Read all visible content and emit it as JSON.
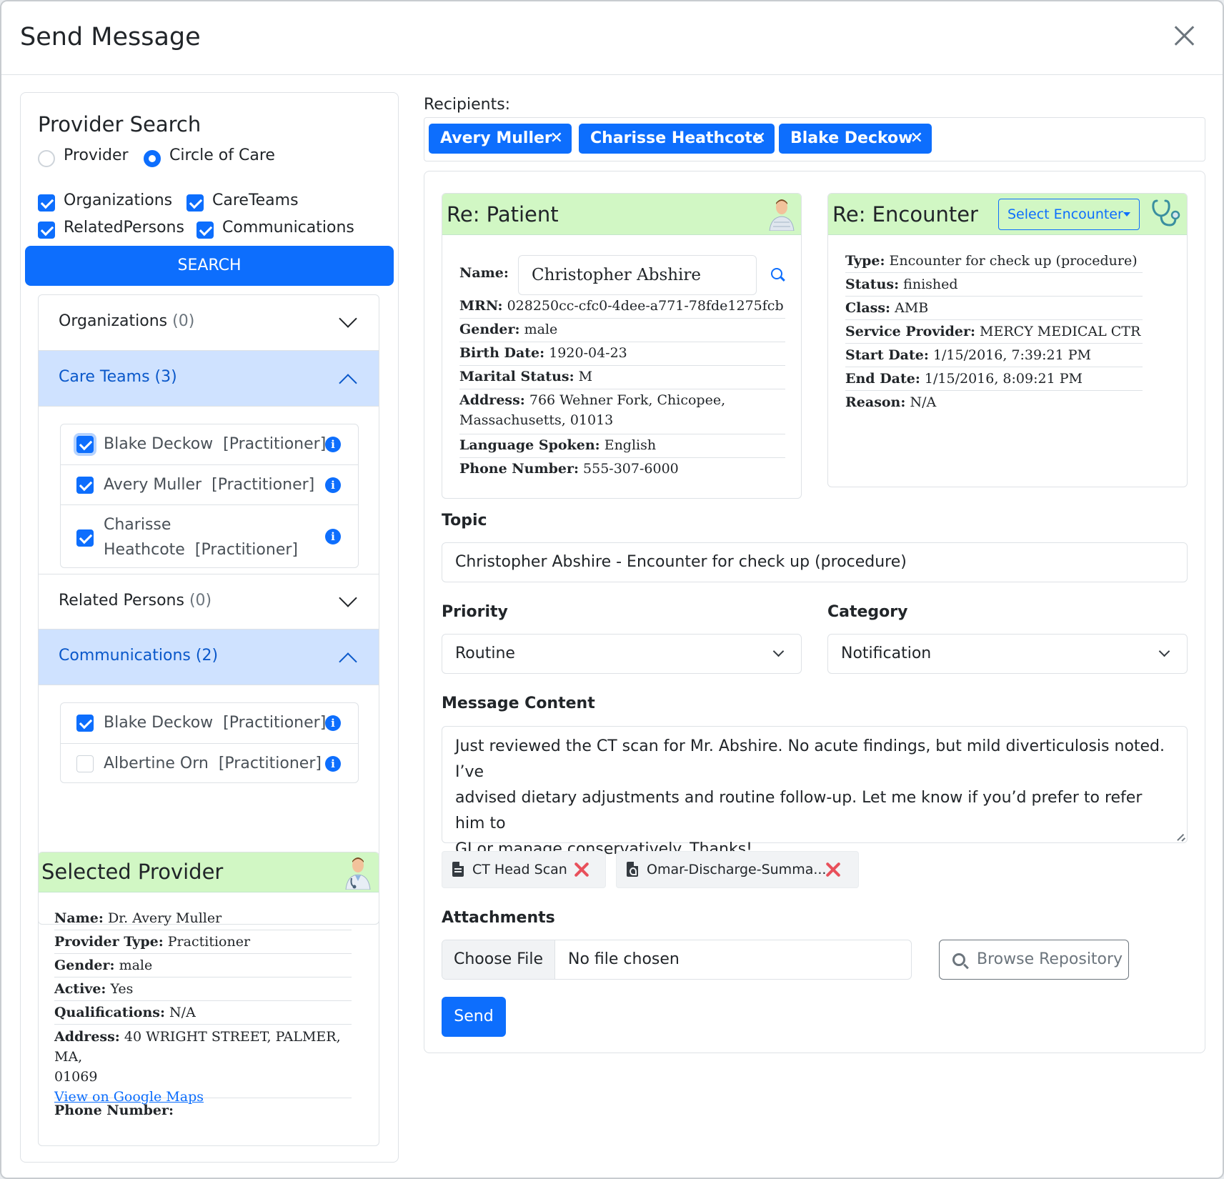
{
  "modal": {
    "title": "Send Message"
  },
  "provider_search": {
    "title": "Provider Search",
    "radios": [
      {
        "label": "Provider",
        "selected": false
      },
      {
        "label": "Circle of Care",
        "selected": true
      }
    ],
    "checkboxes": [
      {
        "label": "Organizations",
        "checked": true
      },
      {
        "label": "CareTeams",
        "checked": true
      },
      {
        "label": "RelatedPersons",
        "checked": true
      },
      {
        "label": "Communications",
        "checked": true
      }
    ],
    "search_label": "SEARCH"
  },
  "accordion": {
    "organizations": {
      "label": "Organizations",
      "count": "(0)"
    },
    "care_teams": {
      "label": "Care Teams",
      "count": "(3)",
      "items": [
        {
          "name": "Blake Deckow",
          "role": "[Practitioner]",
          "checked": true
        },
        {
          "name": "Avery Muller",
          "role": "[Practitioner]",
          "checked": true
        },
        {
          "name": "Charisse",
          "name2": "Heathcote",
          "role": "[Practitioner]",
          "checked": true
        }
      ]
    },
    "related_persons": {
      "label": "Related Persons",
      "count": "(0)"
    },
    "communications": {
      "label": "Communications",
      "count": "(2)",
      "items": [
        {
          "name": "Blake Deckow",
          "role": "[Practitioner]",
          "checked": true
        },
        {
          "name": "Albertine Orn",
          "role": "[Practitioner]",
          "checked": false
        }
      ]
    }
  },
  "selected_provider": {
    "title": "Selected Provider",
    "rows": [
      {
        "key": "Name:",
        "value": "Dr. Avery Muller"
      },
      {
        "key": "Provider Type:",
        "value": "Practitioner"
      },
      {
        "key": "Gender:",
        "value": "male"
      },
      {
        "key": "Active:",
        "value": "Yes"
      },
      {
        "key": "Qualifications:",
        "value": "N/A"
      },
      {
        "key": "Address:",
        "value": "40 WRIGHT STREET, PALMER, MA,",
        "value2": "01069"
      },
      {
        "key": "Phone Number:",
        "value": ""
      }
    ],
    "maps_link": "View on Google Maps"
  },
  "recipients": {
    "label": "Recipients:",
    "chips": [
      "Avery Muller",
      "Charisse Heathcote",
      "Blake Deckow"
    ],
    "remove_glyph": "✕"
  },
  "patient": {
    "title": "Re: Patient",
    "name_label": "Name:",
    "name_value": "Christopher Abshire",
    "rows": [
      {
        "key": "MRN:",
        "value": "028250cc-cfc0-4dee-a771-78fde1275fcb"
      },
      {
        "key": "Gender:",
        "value": "male"
      },
      {
        "key": "Birth Date:",
        "value": "1920-04-23"
      },
      {
        "key": "Marital Status:",
        "value": "M"
      },
      {
        "key": "Address:",
        "value": "766 Wehner Fork, Chicopee,",
        "value2": "Massachusetts, 01013"
      },
      {
        "key": "Language Spoken:",
        "value": "English"
      },
      {
        "key": "Phone Number:",
        "value": "555-307-6000"
      }
    ]
  },
  "encounter": {
    "title": "Re: Encounter",
    "select_label": "Select Encounter",
    "rows": [
      {
        "key": "Type:",
        "value": "Encounter for check up (procedure)"
      },
      {
        "key": "Status:",
        "value": "finished"
      },
      {
        "key": "Class:",
        "value": "AMB"
      },
      {
        "key": "Service Provider:",
        "value": "MERCY MEDICAL CTR"
      },
      {
        "key": "Start Date:",
        "value": "1/15/2016, 7:39:21 PM"
      },
      {
        "key": "End Date:",
        "value": "1/15/2016, 8:09:21 PM"
      },
      {
        "key": "Reason:",
        "value": "N/A"
      }
    ]
  },
  "form": {
    "topic_label": "Topic",
    "topic_value": "Christopher Abshire - Encounter for check up (procedure)",
    "priority_label": "Priority",
    "priority_value": "Routine",
    "category_label": "Category",
    "category_value": "Notification",
    "message_label": "Message Content",
    "message_lines": [
      "Just reviewed the CT scan for Mr. Abshire. No acute findings, but mild diverticulosis noted. I’ve",
      "advised dietary adjustments and routine follow-up. Let me know if you’d prefer to refer him to",
      "GI or manage conservatively. Thanks!"
    ],
    "attached": [
      "CT Head Scan",
      "Omar-Discharge-Summa..."
    ],
    "attachments_label": "Attachments",
    "choose_file": "Choose File",
    "no_file": "No file chosen",
    "browse": "Browse Repository",
    "send": "Send"
  },
  "colors": {
    "primary": "#0d6efd",
    "accordion_open": "#cfe2ff",
    "card_header": "#d1f7c4",
    "remove_red": "#e8505b"
  }
}
